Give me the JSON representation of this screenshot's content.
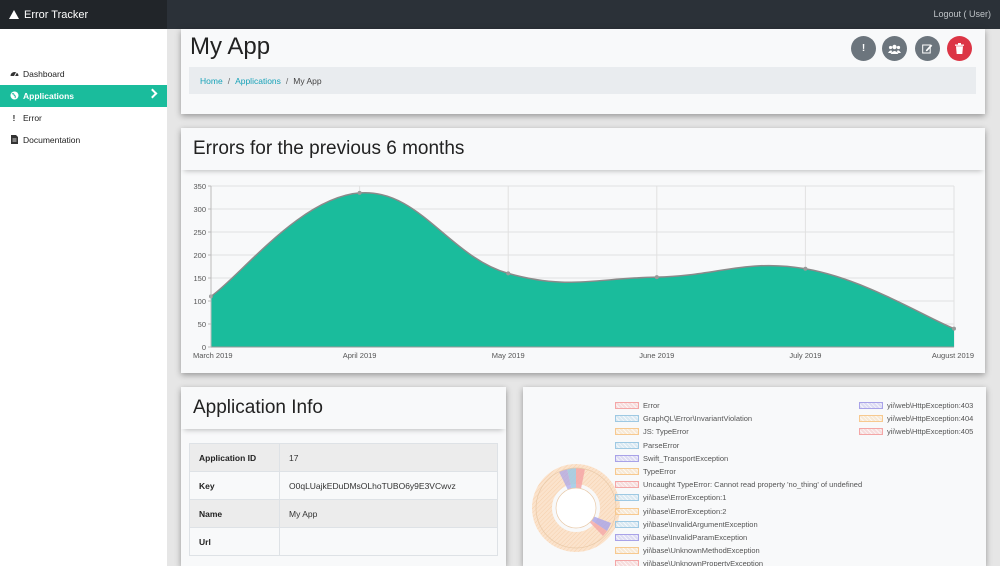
{
  "app": {
    "title": "Error Tracker",
    "logout": "Logout ( User)"
  },
  "sidebar": {
    "items": [
      {
        "label": "Dashboard",
        "icon": "dashboard-icon"
      },
      {
        "label": "Applications",
        "icon": "globe-icon"
      },
      {
        "label": "Error",
        "icon": "exclamation-icon"
      },
      {
        "label": "Documentation",
        "icon": "document-icon"
      }
    ]
  },
  "header": {
    "title": "My App",
    "breadcrumb": [
      "Home",
      "Applications",
      "My App"
    ],
    "actions": [
      {
        "icon": "exclamation-icon"
      },
      {
        "icon": "users-icon"
      },
      {
        "icon": "edit-icon"
      },
      {
        "icon": "trash-icon"
      }
    ]
  },
  "chart_section": {
    "title": "Errors for the previous 6 months"
  },
  "chart_data": {
    "type": "area",
    "x": [
      "March 2019",
      "April 2019",
      "May 2019",
      "June 2019",
      "July 2019",
      "August 2019"
    ],
    "values": [
      110,
      335,
      160,
      152,
      170,
      40
    ],
    "ylim": [
      0,
      350
    ],
    "yticks": [
      0,
      50,
      100,
      150,
      200,
      250,
      300,
      350
    ],
    "grid": true,
    "fill_color": "#1abc9c",
    "line_color": "#8a8a8a"
  },
  "info": {
    "title": "Application Info",
    "rows": [
      {
        "key": "Application ID",
        "value": "17"
      },
      {
        "key": "Key",
        "value": "O0qLUajkEDuDMsOLhoTUBO6y9E3VCwvz"
      },
      {
        "key": "Name",
        "value": "My App"
      },
      {
        "key": "Url",
        "value": ""
      }
    ]
  },
  "pie": {
    "legend_left": [
      {
        "label": "Error",
        "color": "#f4a6a6"
      },
      {
        "label": "GraphQL\\Error\\InvariantViolation",
        "color": "#9ec9e3"
      },
      {
        "label": "JS: TypeError",
        "color": "#f7c98f"
      },
      {
        "label": "ParseError",
        "color": "#9ec9e3"
      },
      {
        "label": "Swift_TransportException",
        "color": "#a8a2e8"
      },
      {
        "label": "TypeError",
        "color": "#f7c98f"
      },
      {
        "label": "Uncaught TypeError: Cannot read property 'no_thing' of undefined",
        "color": "#f4a6a6"
      },
      {
        "label": "yii\\base\\ErrorException:1",
        "color": "#9ec9e3"
      },
      {
        "label": "yii\\base\\ErrorException:2",
        "color": "#f7c98f"
      },
      {
        "label": "yii\\base\\InvalidArgumentException",
        "color": "#9ec9e3"
      },
      {
        "label": "yii\\base\\InvalidParamException",
        "color": "#a8a2e8"
      },
      {
        "label": "yii\\base\\UnknownMethodException",
        "color": "#f7c98f"
      },
      {
        "label": "yii\\base\\UnknownPropertyException",
        "color": "#f4a6a6"
      }
    ],
    "legend_right": [
      {
        "label": "yii\\web\\HttpException:403",
        "color": "#a8a2e8"
      },
      {
        "label": "yii\\web\\HttpException:404",
        "color": "#f7c98f"
      },
      {
        "label": "yii\\web\\HttpException:405",
        "color": "#f4a6a6"
      }
    ]
  }
}
